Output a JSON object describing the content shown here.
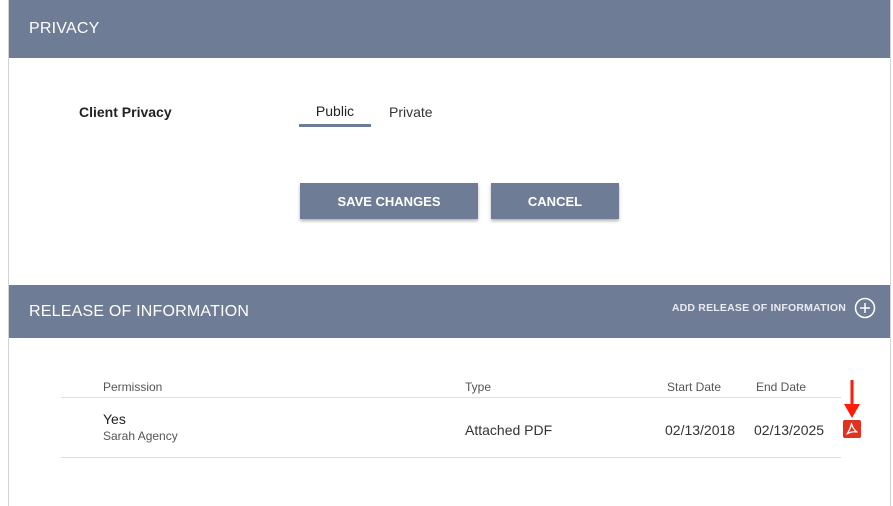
{
  "privacy": {
    "header_title": "PRIVACY",
    "client_privacy_label": "Client Privacy",
    "options": [
      "Public",
      "Private"
    ],
    "selected_option": "Public",
    "save_label": "SAVE CHANGES",
    "cancel_label": "CANCEL"
  },
  "release_of_information": {
    "header_title": "RELEASE OF INFORMATION",
    "add_label": "ADD RELEASE OF INFORMATION",
    "columns": [
      "Permission",
      "Type",
      "Start Date",
      "End Date"
    ],
    "rows": [
      {
        "permission": "Yes",
        "agency": "Sarah Agency",
        "type": "Attached PDF",
        "start_date": "02/13/2018",
        "end_date": "02/13/2025",
        "attachment_icon": "pdf-icon"
      }
    ]
  },
  "colors": {
    "header_bg": "#6f7c95",
    "pdf_red": "#e0321f",
    "arrow_red": "#ff1a0a"
  }
}
